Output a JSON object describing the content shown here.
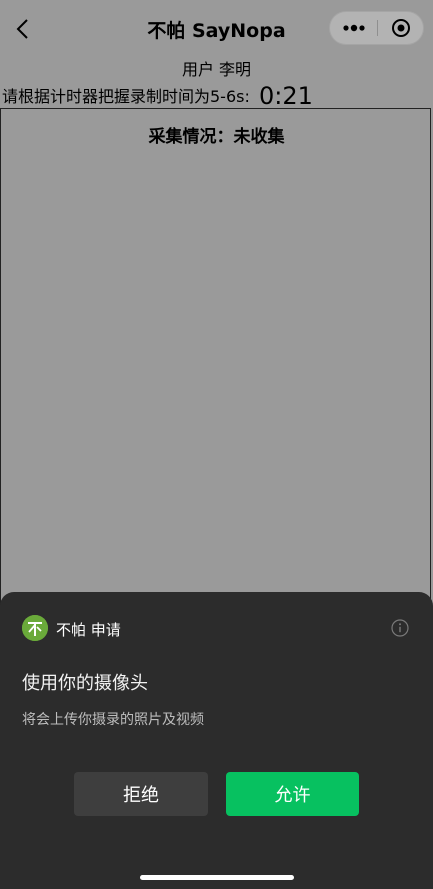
{
  "navbar": {
    "title": "不帕 SayNopa"
  },
  "user": {
    "label": "用户 李明"
  },
  "timer": {
    "instruction": "请根据计时器把握录制时间为5-6s:",
    "value": "0:21"
  },
  "collect": {
    "status": "采集情况：未收集"
  },
  "sheet": {
    "app_name": "不帕 申请",
    "logo_char": "不",
    "title": "使用你的摄像头",
    "description": "将会上传你摄录的照片及视频",
    "deny_label": "拒绝",
    "allow_label": "允许"
  },
  "colors": {
    "allow": "#07c160",
    "sheet": "#2c2c2c",
    "background": "#9a9a9a",
    "logo": "#6aaa3a"
  },
  "icons": [
    "back-icon",
    "more-icon",
    "close-mini-program-icon",
    "app-logo-icon",
    "info-icon"
  ]
}
